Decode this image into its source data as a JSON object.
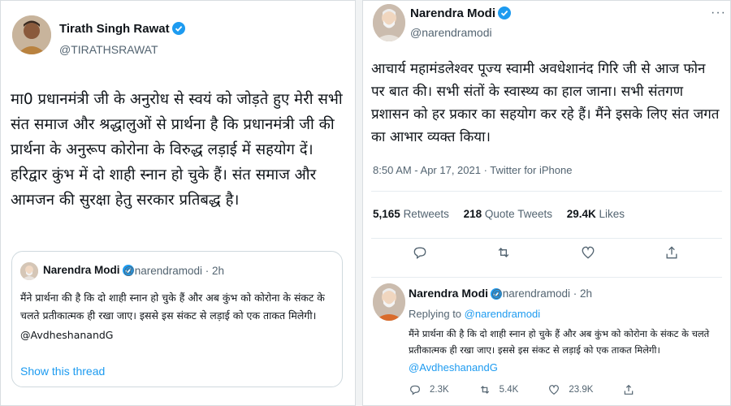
{
  "left_tweet": {
    "author_name": "Tirath Singh Rawat",
    "author_handle": "@TIRATHSRAWAT",
    "text": "मा0 प्रधानमंत्री जी के अनुरोध से स्वयं को जोड़ते हुए मेरी सभी संत समाज और श्रद्धालुओं से प्रार्थना है कि प्रधानमंत्री जी की प्रार्थना के अनुरूप कोरोना के विरुद्ध लड़ाई में सहयोग दें। हरिद्वार कुंभ में दो शाही स्नान हो चुके हैं। संत समाज और आमजन की सुरक्षा हेतु सरकार प्रतिबद्ध है।",
    "quoted": {
      "author_name": "Narendra Modi",
      "author_handle": "@narendramodi · 2h",
      "text": "मैंने प्रार्थना की है कि दो शाही स्नान हो चुके हैं और अब कुंभ को कोरोना के संकट के चलते प्रतीकात्मक ही रखा जाए। इससे इस संकट से लड़ाई को एक ताकत मिलेगी।",
      "mention": "@AvdheshanandG",
      "show_thread": "Show this thread"
    }
  },
  "right_tweet": {
    "author_name": "Narendra Modi",
    "author_handle": "@narendramodi",
    "more_label": "···",
    "text": "आचार्य महामंडलेश्वर पूज्य स्वामी अवधेशानंद गिरि जी से आज फोन पर बात की। सभी संतों के स्वास्थ्य का हाल जाना। सभी संतगण प्रशासन को हर प्रकार का सहयोग कर रहे हैं। मैंने इसके लिए संत जगत का आभार व्यक्त किया।",
    "meta": "8:50 AM - Apr 17, 2021 · Twitter for iPhone",
    "stats": {
      "retweets_count": "5,165",
      "retweets_label": "Retweets",
      "quotes_count": "218",
      "quotes_label": "Quote Tweets",
      "likes_count": "29.4K",
      "likes_label": "Likes"
    },
    "reply": {
      "author_name": "Narendra Modi",
      "author_handle": "@narendramodi · 2h",
      "replying_prefix": "Replying to",
      "replying_to": "@narendramodi",
      "text": "मैंने प्रार्थना की है कि दो शाही स्नान हो चुके हैं और अब कुंभ को कोरोना के संकट के चलते प्रतीकात्मक ही रखा जाए। इससे इस संकट से लड़ाई को एक ताकत मिलेगी।",
      "mention": "@AvdheshanandG",
      "replies": "2.3K",
      "retweets": "5.4K",
      "likes": "23.9K"
    }
  },
  "icons": {
    "verified": "verified-badge-icon",
    "reply": "reply-icon",
    "retweet": "retweet-icon",
    "like": "heart-icon",
    "share": "share-icon"
  },
  "colors": {
    "accent": "#1d9bf0",
    "text": "#0f1419",
    "muted": "#536471",
    "border": "#cfd9de"
  }
}
